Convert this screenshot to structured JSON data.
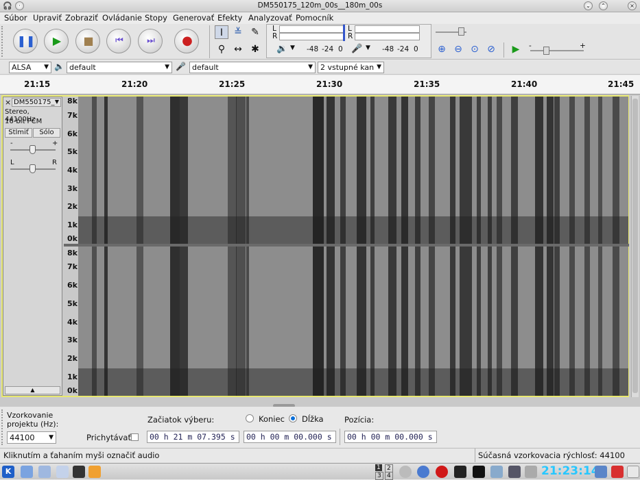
{
  "window": {
    "title": "DM550175_120m_00s__180m_00s"
  },
  "menu": [
    "Súbor",
    "Upraviť",
    "Zobraziť",
    "Ovládanie",
    "Stopy",
    "Generovať",
    "Efekty",
    "Analyzovať",
    "Pomocník"
  ],
  "meters": {
    "play_l": "L",
    "play_r": "R",
    "rec_l": "L",
    "rec_r": "R",
    "play_scale": [
      "-48",
      "-24",
      "0"
    ],
    "rec_scale": [
      "-48",
      "-24",
      "0"
    ]
  },
  "devices": {
    "host": "ALSA",
    "output": "default",
    "input": "default",
    "channels": "2 vstupné kan"
  },
  "ruler": [
    "21:15",
    "21:20",
    "21:25",
    "21:30",
    "21:35",
    "21:40",
    "21:45"
  ],
  "track": {
    "name": "DM550175_",
    "format": "Stereo, 44100Hz",
    "bits": "16-bit PCM",
    "mute": "Stlmiť",
    "solo": "Sólo",
    "gain_minus": "-",
    "gain_plus": "+",
    "pan_l": "L",
    "pan_r": "R",
    "collapse": "▲"
  },
  "freq_labels": [
    "8k",
    "7k",
    "6k",
    "5k",
    "4k",
    "3k",
    "2k",
    "1k",
    "0k"
  ],
  "selection": {
    "rate_label": "Vzorkovanie projektu (Hz):",
    "rate_value": "44100",
    "snap_label": "Prichytávať",
    "start_label": "Začiatok výberu:",
    "end_option": "Koniec",
    "length_option": "Dĺžka",
    "position_label": "Pozícia:",
    "start_value": "00 h 21 m 07.395 s",
    "length_value": "00 h 00 m 00.000 s",
    "position_value": "00 h 00 m 00.000 s"
  },
  "status": {
    "left": "Kliknutím a ťahaním myši označiť audio",
    "right": "Súčasná vzorkovacia rýchlosť: 44100"
  },
  "taskbar": {
    "clock": "21:23:14",
    "pager": [
      "1",
      "2",
      "3",
      "4"
    ]
  },
  "colors": {
    "accent": "#0a6fd8",
    "clock": "#27c7ff"
  }
}
